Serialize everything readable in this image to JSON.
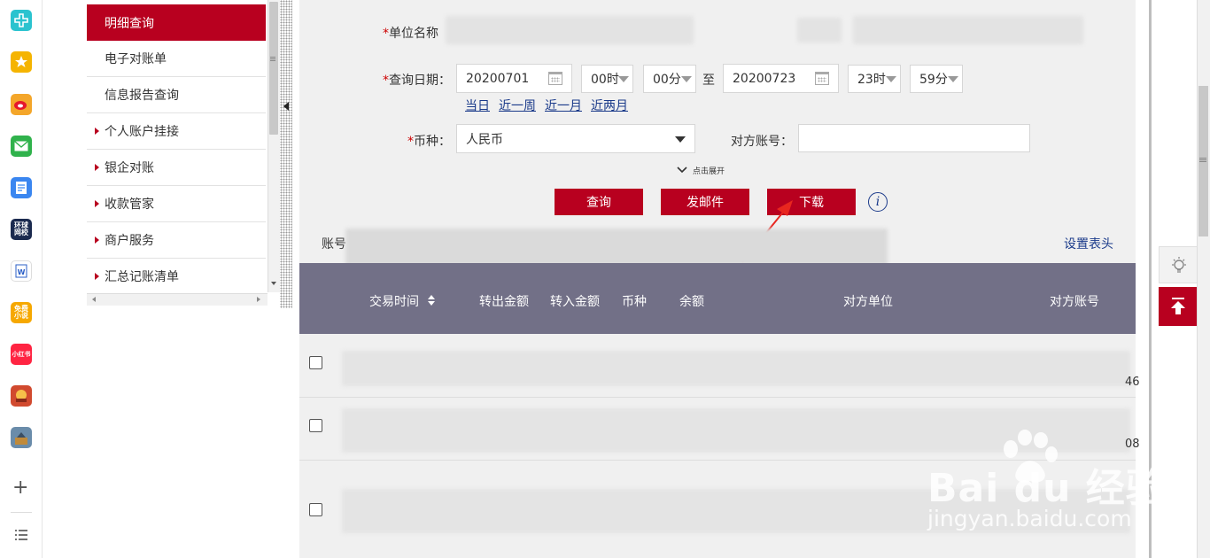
{
  "dock": {
    "items": [
      {
        "icon": "medical-cross-icon",
        "color": "#2bc3cf"
      },
      {
        "icon": "star-icon",
        "color": "#f5b400"
      },
      {
        "icon": "weibo-icon",
        "color": "#f4a62a"
      },
      {
        "icon": "mail-icon",
        "color": "#30b24c"
      },
      {
        "icon": "document-edit-icon",
        "color": "#3a86f0"
      },
      {
        "icon": "news-app-icon",
        "color": "#1b2a4f",
        "text": "环球\n网校"
      },
      {
        "icon": "word-icon",
        "color": "#ffffff"
      },
      {
        "icon": "novel-app-icon",
        "color": "#f6a800",
        "text": "免费\n小说"
      },
      {
        "icon": "xiaohongshu-icon",
        "color": "#ff2442",
        "text": "小红书"
      },
      {
        "icon": "game-app-icon",
        "color": "#d14a2f"
      },
      {
        "icon": "game-app-icon-2",
        "color": "#6a8caa"
      }
    ],
    "add": "+",
    "list": "≡"
  },
  "menu": {
    "items": [
      {
        "label": "明细查询",
        "active": true,
        "expandable": false
      },
      {
        "label": "电子对账单",
        "active": false,
        "expandable": false
      },
      {
        "label": "信息报告查询",
        "active": false,
        "expandable": false
      },
      {
        "label": "个人账户挂接",
        "active": false,
        "expandable": true
      },
      {
        "label": "银企对账",
        "active": false,
        "expandable": true
      },
      {
        "label": "收款管家",
        "active": false,
        "expandable": true
      },
      {
        "label": "商户服务",
        "active": false,
        "expandable": true
      },
      {
        "label": "汇总记账清单",
        "active": false,
        "expandable": true
      }
    ]
  },
  "form": {
    "unit_label": "单位名称",
    "date_label": "查询日期：",
    "start_date": "20200701",
    "start_hour": "00时",
    "start_min": "00分",
    "to": "至",
    "end_date": "20200723",
    "end_hour": "23时",
    "end_min": "59分",
    "quick": [
      "当日",
      "近一周",
      "近一月",
      "近两月"
    ],
    "currency_label": "币种：",
    "currency_value": "人民币",
    "counter_account_label": "对方账号：",
    "counter_account_value": "",
    "expand_label": "点击展开",
    "required_mark": "*"
  },
  "actions": {
    "query": "查询",
    "email": "发邮件",
    "download": "下载",
    "info": "i"
  },
  "account": {
    "label": "账号",
    "set_header": "设置表头"
  },
  "table": {
    "headers": [
      "交易时间",
      "转出金额",
      "转入金额",
      "币种",
      "余额",
      "对方单位",
      "对方账号"
    ]
  },
  "right": {
    "row_suffixes": [
      "46",
      "08"
    ]
  },
  "watermark": {
    "brand": "Bai  du 经验",
    "url": "jingyan.baidu.com"
  },
  "colors": {
    "accent": "#b8001f",
    "table_header": "#727087",
    "link": "#1a3a8a"
  }
}
